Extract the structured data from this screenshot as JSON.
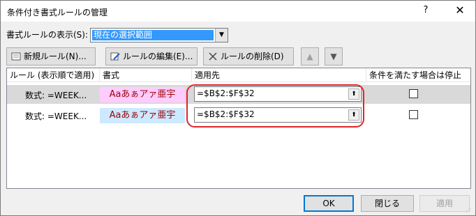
{
  "window": {
    "title": "条件付き書式ルールの管理"
  },
  "scope": {
    "label": "書式ルールの表示(S):",
    "selected": "現在の選択範囲"
  },
  "toolbar": {
    "new_label": "新規ルール(N)...",
    "edit_label": "ルールの編集(E)...",
    "delete_label": "ルールの削除(D)"
  },
  "grid": {
    "headers": [
      "ルール (表示順で適用)",
      "書式",
      "適用先",
      "条件を満たす場合は停止"
    ],
    "rows": [
      {
        "rule": "数式: =WEEK...",
        "preview": "Aaあぁアァ亜宇",
        "applies_to": "=$B$2:$F$32",
        "preview_bg": "#ffccff",
        "stop": false
      },
      {
        "rule": "数式: =WEEK...",
        "preview": "Aaあぁアァ亜宇",
        "applies_to": "=$B$2:$F$32",
        "preview_bg": "#cce9ff",
        "stop": false
      }
    ]
  },
  "buttons": {
    "ok": "OK",
    "close": "閉じる",
    "apply": "適用"
  }
}
